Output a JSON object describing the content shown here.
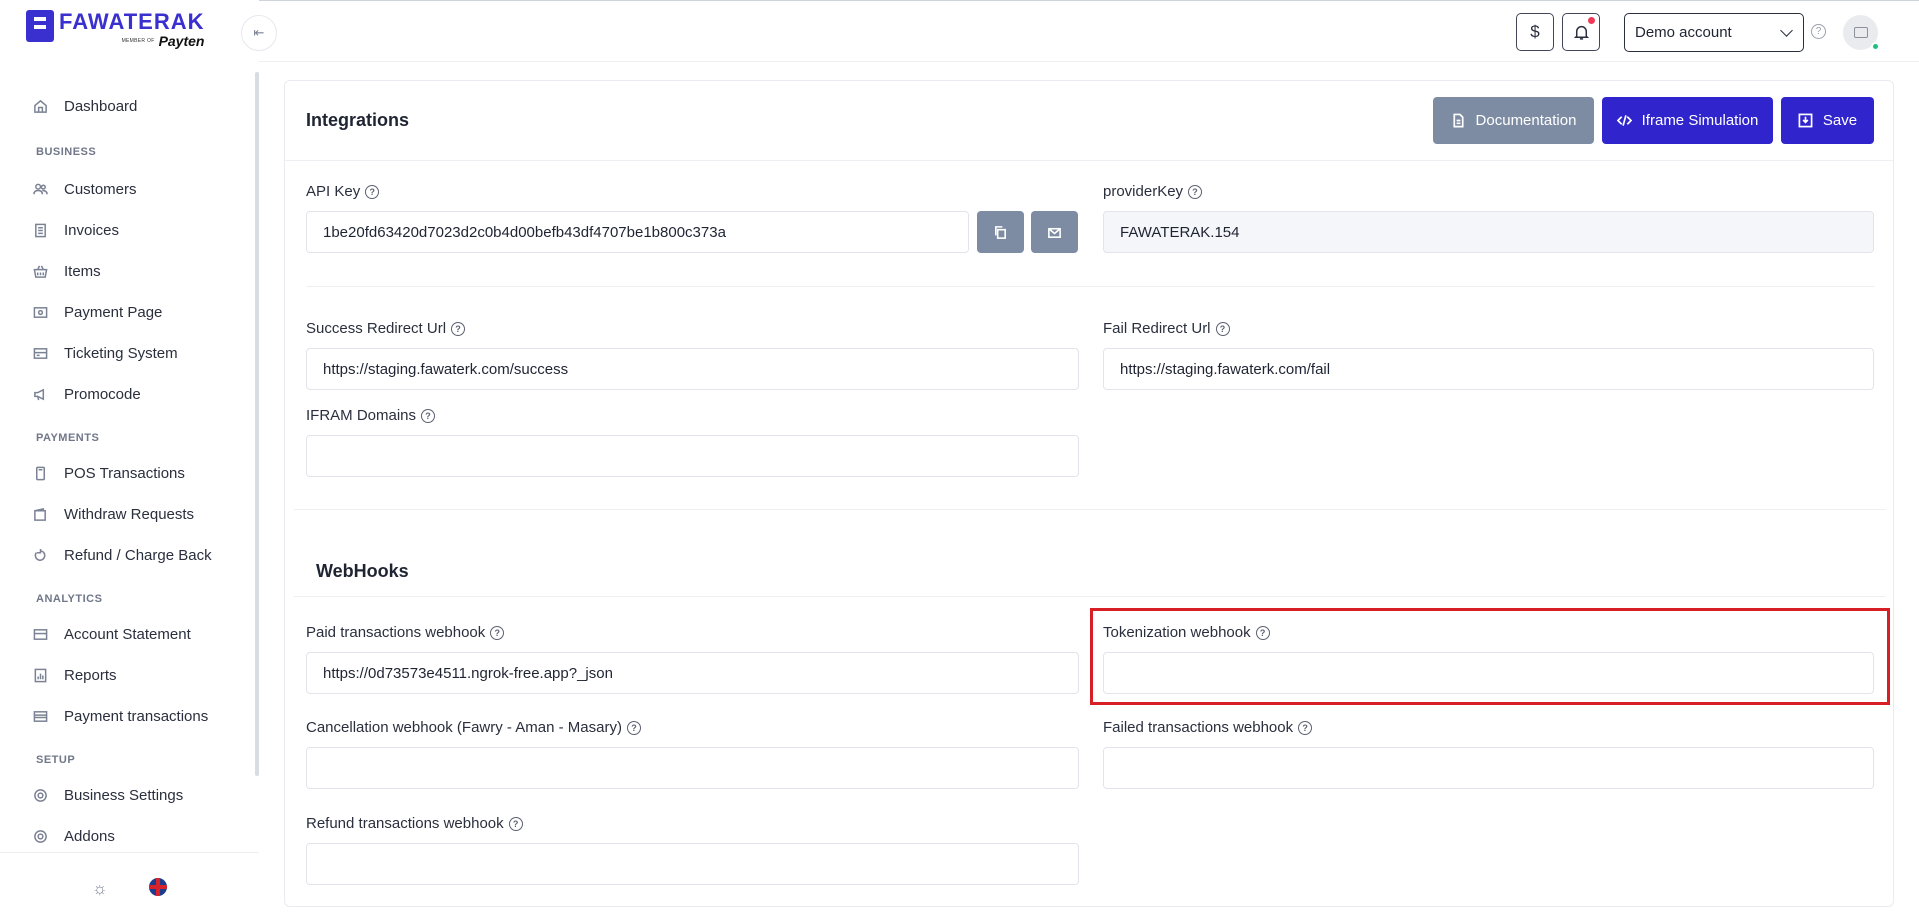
{
  "brand": {
    "name": "FAWATERAK",
    "member_of": "MEMBER OF",
    "partner": "Payten"
  },
  "sidebar": {
    "items": [
      {
        "label": "Dashboard",
        "icon": "home-icon"
      },
      {
        "label": "Customers",
        "icon": "users-icon"
      },
      {
        "label": "Invoices",
        "icon": "invoice-icon"
      },
      {
        "label": "Items",
        "icon": "basket-icon"
      },
      {
        "label": "Payment Page",
        "icon": "payment-page-icon"
      },
      {
        "label": "Ticketing System",
        "icon": "ticket-icon"
      },
      {
        "label": "Promocode",
        "icon": "megaphone-icon"
      },
      {
        "label": "POS Transactions",
        "icon": "pos-icon"
      },
      {
        "label": "Withdraw Requests",
        "icon": "wallet-icon"
      },
      {
        "label": "Refund / Charge Back",
        "icon": "refund-icon"
      },
      {
        "label": "Account Statement",
        "icon": "statement-icon"
      },
      {
        "label": "Reports",
        "icon": "reports-icon"
      },
      {
        "label": "Payment transactions",
        "icon": "card-icon"
      },
      {
        "label": "Business Settings",
        "icon": "gear-icon"
      },
      {
        "label": "Addons",
        "icon": "addons-icon"
      }
    ],
    "sections": [
      "BUSINESS",
      "PAYMENTS",
      "ANALYTICS",
      "SETUP"
    ]
  },
  "header": {
    "currency_symbol": "$",
    "account_selected": "Demo account"
  },
  "page": {
    "title": "Integrations",
    "buttons": {
      "documentation": "Documentation",
      "iframe": "Iframe Simulation",
      "save": "Save"
    },
    "api_key": {
      "label": "API Key",
      "value": "1be20fd63420d7023d2c0b4d00befb43df4707be1b800c373a"
    },
    "provider_key": {
      "label": "providerKey",
      "value": "FAWATERAK.154"
    },
    "success_url": {
      "label": "Success Redirect Url",
      "value": "https://staging.fawaterk.com/success"
    },
    "fail_url": {
      "label": "Fail Redirect Url",
      "value": "https://staging.fawaterk.com/fail"
    },
    "iframe_domains": {
      "label": "IFRAM Domains",
      "value": ""
    },
    "webhooks": {
      "title": "WebHooks",
      "paid": {
        "label": "Paid transactions webhook",
        "value": "https://0d73573e4511.ngrok-free.app?_json"
      },
      "tokenization": {
        "label": "Tokenization webhook",
        "value": ""
      },
      "cancellation": {
        "label": "Cancellation webhook (Fawry - Aman - Masary)",
        "value": ""
      },
      "failed": {
        "label": "Failed transactions webhook",
        "value": ""
      },
      "refund": {
        "label": "Refund transactions webhook",
        "value": ""
      }
    }
  },
  "colors": {
    "primary": "#3024cc",
    "secondary": "#7d8ca3",
    "highlight": "#d81f26"
  }
}
